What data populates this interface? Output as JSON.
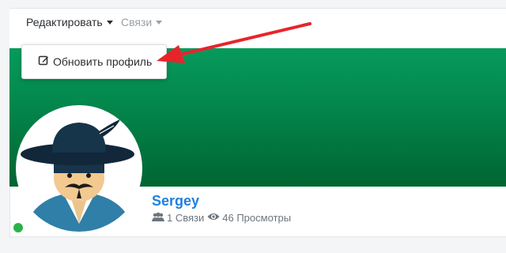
{
  "toolbar": {
    "edit_menu_label": "Редактировать",
    "links_menu_label": "Связи"
  },
  "dropdown": {
    "update_profile_label": "Обновить профиль",
    "icon": "edit-icon"
  },
  "profile": {
    "name": "Sergey",
    "connections_text": "1 Связи",
    "views_text": "46 Просмотры",
    "status": "online"
  },
  "colors": {
    "cover_top": "#079a5d",
    "cover_bottom": "#006532",
    "name_link": "#1f7fe0",
    "annotation_arrow": "#e8242b",
    "online_dot": "#2bb24c"
  }
}
